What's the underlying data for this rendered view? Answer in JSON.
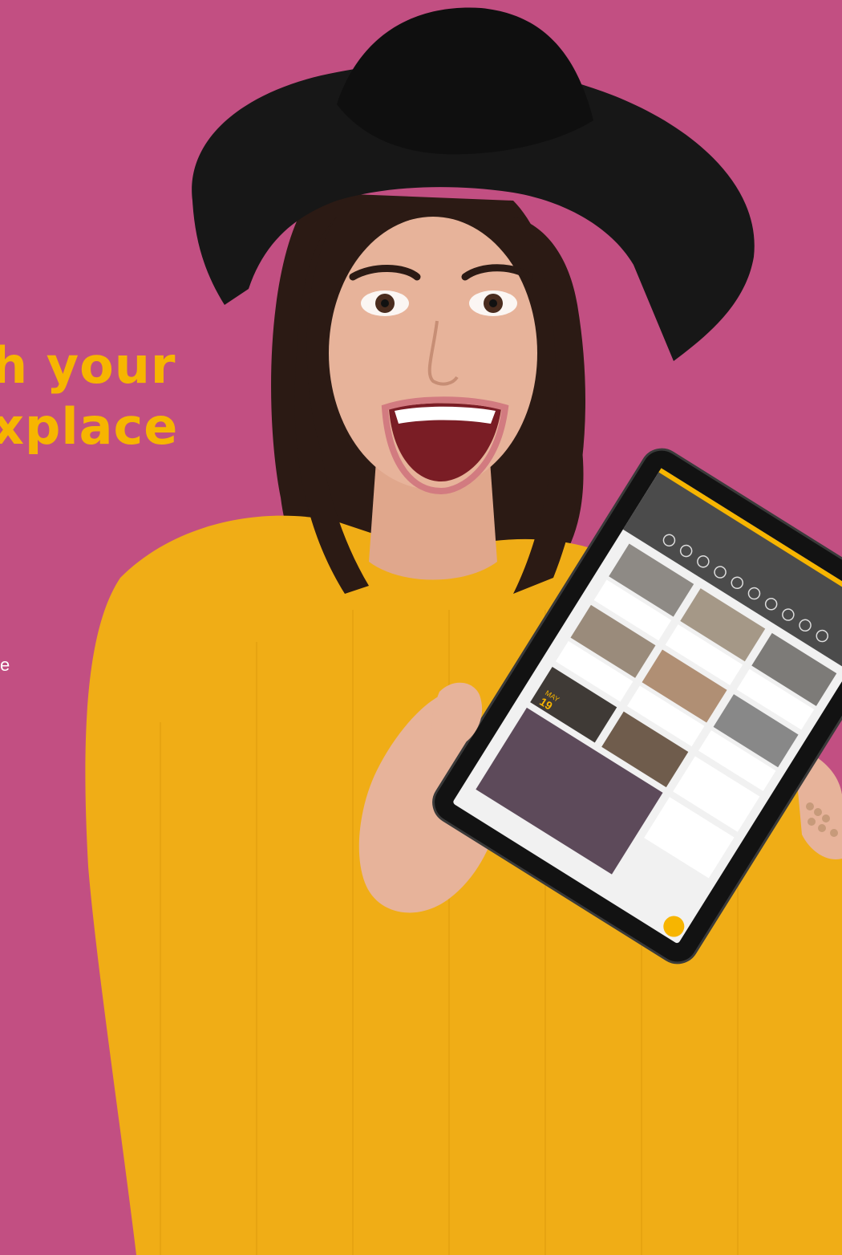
{
  "headline": {
    "line1": "h your",
    "line2": "xplace"
  },
  "fragment_text": "e",
  "tablet_screen": {
    "date_month": "MAY",
    "date_day": "19"
  },
  "colors": {
    "background": "#c24f82",
    "accent": "#f7b500",
    "sweater": "#f0ad16",
    "hat": "#171717",
    "hair": "#2b1a14",
    "skin": "#e7b39a",
    "tablet_frame": "#121212"
  }
}
